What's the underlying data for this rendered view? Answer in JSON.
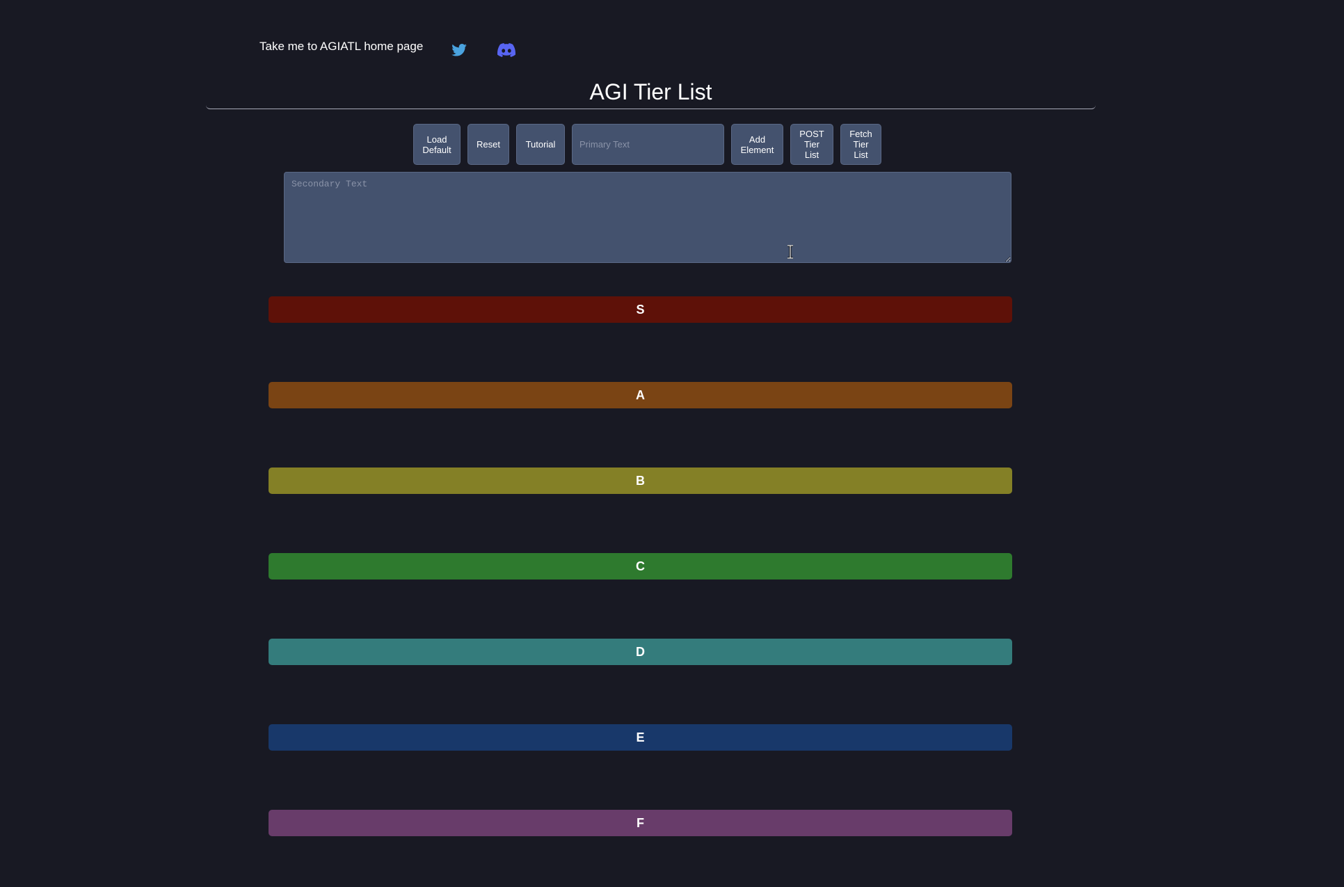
{
  "nav": {
    "home_link": "Take me to AGIATL home page",
    "twitter_icon": "twitter-icon",
    "discord_icon": "discord-icon"
  },
  "header": {
    "title": "AGI Tier List"
  },
  "toolbar": {
    "load_default": "Load\nDefault",
    "reset": "Reset",
    "tutorial": "Tutorial",
    "primary_placeholder": "Primary Text",
    "primary_value": "",
    "add_element": "Add\nElement",
    "post_tier_list": "POST\nTier\nList",
    "fetch_tier_list": "Fetch\nTier\nList"
  },
  "secondary": {
    "placeholder": "Secondary Text",
    "value": ""
  },
  "tiers": [
    {
      "label": "S",
      "color": "#5e1108"
    },
    {
      "label": "A",
      "color": "#7a4414"
    },
    {
      "label": "B",
      "color": "#848026"
    },
    {
      "label": "C",
      "color": "#2e7a2e"
    },
    {
      "label": "D",
      "color": "#347c7c"
    },
    {
      "label": "E",
      "color": "#18386a"
    },
    {
      "label": "F",
      "color": "#683c6a"
    }
  ],
  "colors": {
    "background": "#181923",
    "control": "#44526e",
    "twitter": "#4aa3df",
    "discord": "#5865f2"
  }
}
